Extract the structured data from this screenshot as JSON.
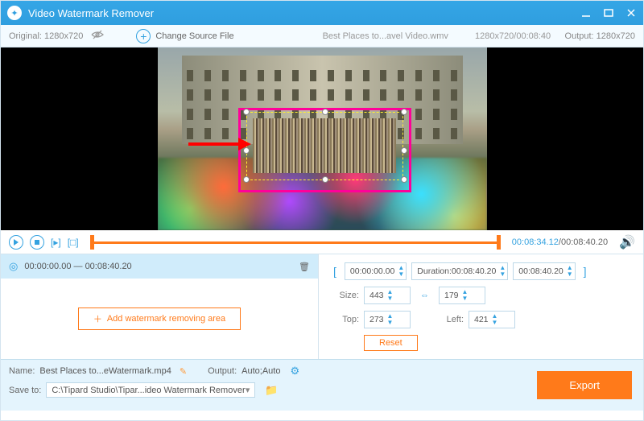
{
  "titlebar": {
    "app_name": "Video Watermark Remover"
  },
  "infobar": {
    "original_label": "Original: 1280x720",
    "change_source": "Change Source File",
    "filename": "Best Places to...avel Video.wmv",
    "filemeta": "1280x720/00:08:40",
    "output_label": "Output: 1280x720"
  },
  "playbar": {
    "current_time": "00:08:34.12",
    "total_time": "/00:08:40.20"
  },
  "segment": {
    "range": "00:00:00.00 — 00:08:40.20"
  },
  "add_area_label": "Add watermark removing area",
  "controls": {
    "start_time": "00:00:00.00",
    "duration_label": "Duration:00:08:40.20",
    "end_time": "00:08:40.20",
    "size_label": "Size:",
    "width": "443",
    "height": "179",
    "top_label": "Top:",
    "top": "273",
    "left_label": "Left:",
    "left": "421",
    "reset": "Reset"
  },
  "footer": {
    "name_label": "Name:",
    "name_value": "Best Places to...eWatermark.mp4",
    "output_label": "Output:",
    "output_value": "Auto;Auto",
    "save_label": "Save to:",
    "save_path": "C:\\Tipard Studio\\Tipar...ideo Watermark Remover",
    "export": "Export"
  }
}
